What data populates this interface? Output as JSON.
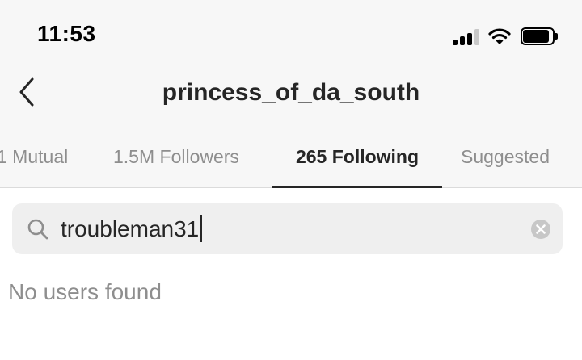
{
  "status_bar": {
    "time": "11:53",
    "signal_bars_active": 3,
    "signal_bars_total": 4,
    "battery_level": 0.88,
    "icons": [
      "cellular-signal-icon",
      "wifi-icon",
      "battery-icon"
    ]
  },
  "header": {
    "back_icon": "chevron-left-icon",
    "title": "princess_of_da_south"
  },
  "tabs": [
    {
      "label": "1 Mutual",
      "active": false
    },
    {
      "label": "1.5M Followers",
      "active": false
    },
    {
      "label": "265 Following",
      "active": true
    },
    {
      "label": "Suggested",
      "active": false
    }
  ],
  "search": {
    "icon": "search-icon",
    "value": "troubleman31",
    "clear_icon": "clear-icon"
  },
  "results": {
    "empty_message": "No users found"
  },
  "colors": {
    "header_bg": "#f7f7f7",
    "text_primary": "#262626",
    "text_secondary": "#8e8e8e",
    "search_bg": "#efefef"
  }
}
